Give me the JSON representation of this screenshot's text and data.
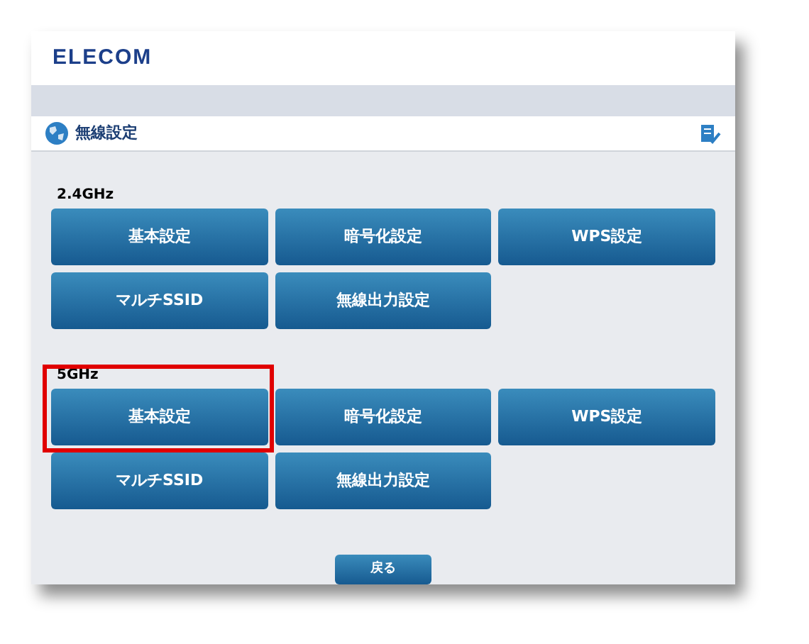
{
  "header": {
    "logo": "ELECOM"
  },
  "page_title": "無線設定",
  "sections": [
    {
      "label": "2.4GHz",
      "buttons": [
        {
          "label": "基本設定",
          "highlighted": false
        },
        {
          "label": "暗号化設定",
          "highlighted": false
        },
        {
          "label": "WPS設定",
          "highlighted": false
        },
        {
          "label": "マルチSSID",
          "highlighted": false
        },
        {
          "label": "無線出力設定",
          "highlighted": false
        }
      ]
    },
    {
      "label": "5GHz",
      "buttons": [
        {
          "label": "基本設定",
          "highlighted": true
        },
        {
          "label": "暗号化設定",
          "highlighted": false
        },
        {
          "label": "WPS設定",
          "highlighted": false
        },
        {
          "label": "マルチSSID",
          "highlighted": false
        },
        {
          "label": "無線出力設定",
          "highlighted": false
        }
      ]
    }
  ],
  "back_button": "戻る"
}
